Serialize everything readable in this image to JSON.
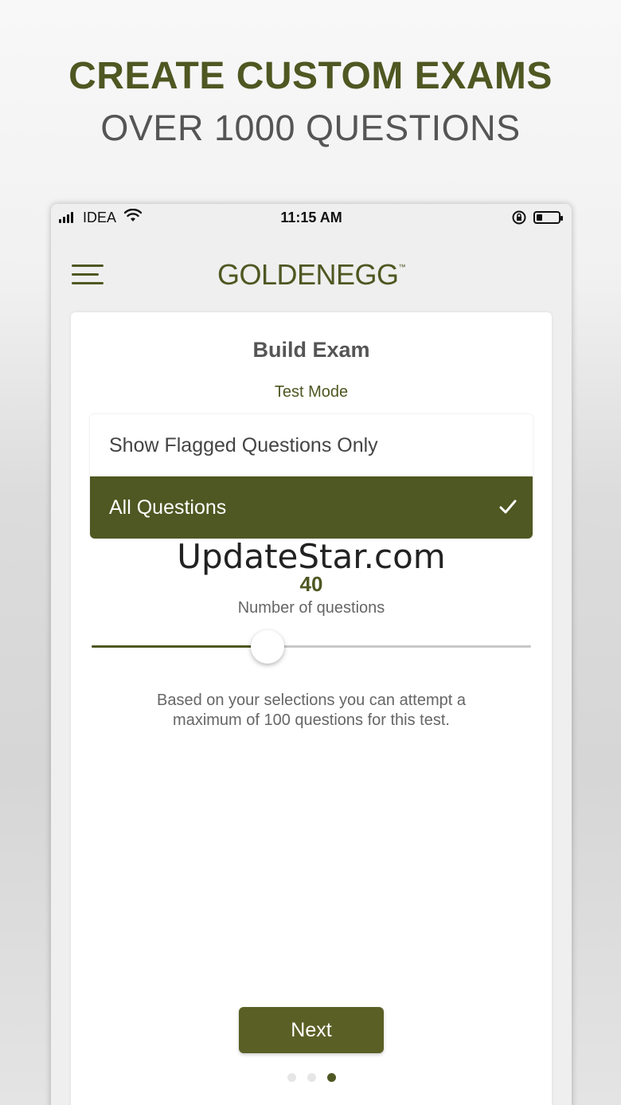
{
  "promo": {
    "headline": "CREATE CUSTOM EXAMS",
    "subheadline": "OVER 1000 QUESTIONS"
  },
  "status_bar": {
    "carrier": "IDEA",
    "time": "11:15 AM",
    "icons": [
      "signal-icon",
      "wifi-icon",
      "orientation-lock-icon",
      "battery-icon"
    ]
  },
  "app_header": {
    "logo": "GOLDENEGG",
    "logo_tm": "™",
    "menu_icon": "hamburger-menu-icon"
  },
  "build_exam": {
    "title": "Build Exam",
    "mode_label": "Test Mode",
    "options": [
      {
        "label": "Show Flagged Questions Only",
        "selected": false
      },
      {
        "label": "All Questions",
        "selected": true
      }
    ],
    "watermark": "UpdateStar.com",
    "question_count": "40",
    "question_count_label": "Number of questions",
    "slider_value": 40,
    "slider_max": 100,
    "info_text": "Based on your selections you can attempt a maximum of 100 questions for this test.",
    "next_label": "Next",
    "pagination": {
      "pages": 3,
      "current": 3
    }
  },
  "colors": {
    "accent": "#4f5722",
    "button": "#5a5f25",
    "text_gray": "#555555"
  }
}
